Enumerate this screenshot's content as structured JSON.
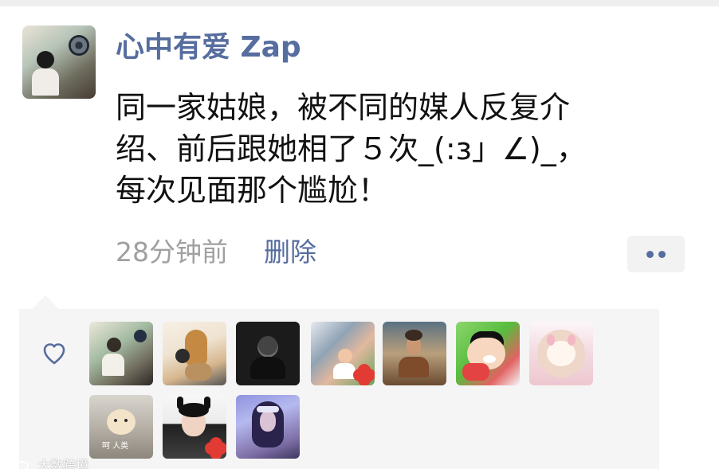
{
  "post": {
    "username": "心中有爱 Zap",
    "content_lines": [
      "同一家姑娘，被不同的媒人反复介",
      "绍、前后跟她相了５次_(:з」∠)_，",
      "每次见面那个尴尬！"
    ],
    "time": "28分钟前",
    "delete_label": "删除"
  },
  "likes": {
    "caption_text": "呵    人类"
  },
  "watermark": {
    "text": "大数跨境"
  },
  "colors": {
    "accent": "#566d9f",
    "timestamp": "#a0a0a0",
    "panel_bg": "#f5f5f5"
  },
  "icons": {
    "heart": "heart-icon",
    "more": "more-dots-icon"
  }
}
